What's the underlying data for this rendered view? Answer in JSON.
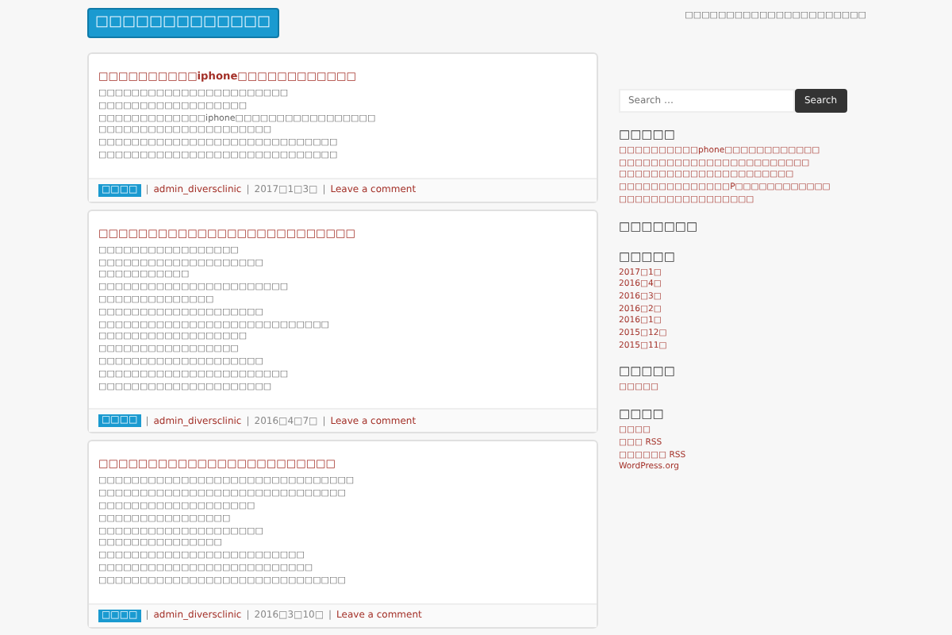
{
  "header": {
    "site_title": "□□□□□□□□□□□□□",
    "tagline": "□□□□□□□□□□□□□□□□□□□□□□"
  },
  "posts": [
    {
      "title": "□□□□□□□□□□iphone□□□□□□□□□□□□",
      "lines": [
        "□□□□□□□□□□□□□□□□□□□□□□□",
        "□□□□□□□□□□□□□□□□□□",
        "□□□□□□□□□□□□□iphone□□□□□□□□□□□□□□□□□",
        "□□□□□□□□□□□□□□□□□□□□□",
        "□□□□□□□□□□□□□□□□□□□□□□□□□□□□□",
        "□□□□□□□□□□□□□□□□□□□□□□□□□□□□□"
      ],
      "category": "□□□□",
      "author": "admin_diversclinic",
      "date": "2017□1□3□",
      "comment_link": "Leave a comment",
      "separator": "|"
    },
    {
      "title": "□□□□□□□□□□□□□□□□□□□□□□□□□□",
      "lines": [
        "□□□□□□□□□□□□□□□□□",
        "□□□□□□□□□□□□□□□□□□□□",
        "□□□□□□□□□□□",
        "□□□□□□□□□□□□□□□□□□□□□□□",
        "□□□□□□□□□□□□□□",
        "□□□□□□□□□□□□□□□□□□□□",
        "□□□□□□□□□□□□□□□□□□□□□□□□□□□□",
        "□□□□□□□□□□□□□□□□□□",
        "□□□□□□□□□□□□□□□□□",
        "□□□□□□□□□□□□□□□□□□□□",
        "□□□□□□□□□□□□□□□□□□□□□□□",
        "□□□□□□□□□□□□□□□□□□□□□"
      ],
      "category": "□□□□",
      "author": "admin_diversclinic",
      "date": "2016□4□7□",
      "comment_link": "Leave a comment",
      "separator": "|"
    },
    {
      "title": "□□□□□□□□□□□□□□□□□□□□□□□□",
      "lines": [
        "□□□□□□□□□□□□□□□□□□□□□□□□□□□□□□□",
        "□□□□□□□□□□□□□□□□□□□□□□□□□□□□□□",
        "□□□□□□□□□□□□□□□□□□□",
        "□□□□□□□□□□□□□□□□",
        "□□□□□□□□□□□□□□□□□□□□",
        "□□□□□□□□□□□□□□□",
        "□□□□□□□□□□□□□□□□□□□□□□□□□",
        "□□□□□□□□□□□□□□□□□□□□□□□□□□",
        "□□□□□□□□□□□□□□□□□□□□□□□□□□□□□□"
      ],
      "category": "□□□□",
      "author": "admin_diversclinic",
      "date": "2016□3□10□",
      "comment_link": "Leave a comment",
      "separator": "|"
    }
  ],
  "sidebar": {
    "search": {
      "placeholder": "Search …",
      "button": "Search"
    },
    "widgets": [
      {
        "title": "□□□□□",
        "links": [
          "□□□□□□□□□□phone□□□□□□□□□□□□",
          "□□□□□□□□□□□□□□□□□□□□□□□□",
          "□□□□□□□□□□□□□□□□□□□□□□",
          "□□□□□□□□□□□□□□P□□□□□□□□□□□□",
          "□□□□□□□□□□□□□□□□□"
        ]
      },
      {
        "title": "□□□□□□□"
      },
      {
        "title": "□□□□□",
        "links": [
          "2017□1□",
          "2016□4□",
          "2016□3□",
          "2016□2□",
          "2016□1□",
          "2015□12□",
          "2015□11□"
        ]
      },
      {
        "title": "□□□□□",
        "links": [
          "□□□□□"
        ]
      },
      {
        "title": "□□□□",
        "links": [
          "□□□□",
          "□□□ RSS",
          "□□□□□□ RSS",
          "WordPress.org"
        ]
      }
    ]
  }
}
